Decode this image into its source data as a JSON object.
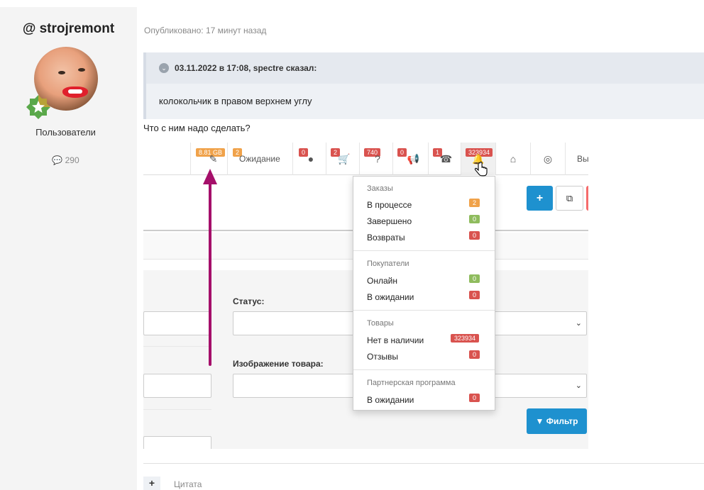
{
  "user": {
    "name": "@ strojremont",
    "group": "Пользователи",
    "message_count": "290"
  },
  "post": {
    "published": "Опубликовано: 17 минут назад",
    "quote_author": "03.11.2022 в 17:08, spectre сказал:",
    "quote_text": "колокольчик в правом верхнем углу",
    "text": "Что с ним надо сделать?"
  },
  "admin_topbar": {
    "disk_badge": "8.81 GB",
    "pending_badge": "2",
    "pending_label": "Ожидание",
    "comments_badge": "0",
    "orders_badge": "2",
    "questions_badge": "740",
    "announce_badge": "0",
    "calls_badge": "1",
    "alerts_badge": "323934",
    "logout_label": "Вы"
  },
  "filter": {
    "status_label": "Статус:",
    "image_label": "Изображение товара:",
    "filter_button": "Фильтр"
  },
  "notifications": {
    "orders_header": "Заказы",
    "in_process": "В процессе",
    "in_process_count": "2",
    "completed": "Завершено",
    "completed_count": "0",
    "returns": "Возвраты",
    "returns_count": "0",
    "customers_header": "Покупатели",
    "online": "Онлайн",
    "online_count": "0",
    "customers_waiting": "В ожидании",
    "customers_waiting_count": "0",
    "products_header": "Товары",
    "out_of_stock": "Нет в наличии",
    "out_of_stock_count": "323934",
    "reviews": "Отзывы",
    "reviews_count": "0",
    "affiliate_header": "Партнерская программа",
    "affiliate_waiting": "В ожидании",
    "affiliate_waiting_count": "0"
  },
  "editor": {
    "quote_button": "Цитата"
  },
  "colors": {
    "badge_red": "#d9534f",
    "badge_green": "#8fbc5e",
    "badge_orange": "#f0a24a",
    "primary_blue": "#1e91cf",
    "arrow": "#a50f6a"
  }
}
